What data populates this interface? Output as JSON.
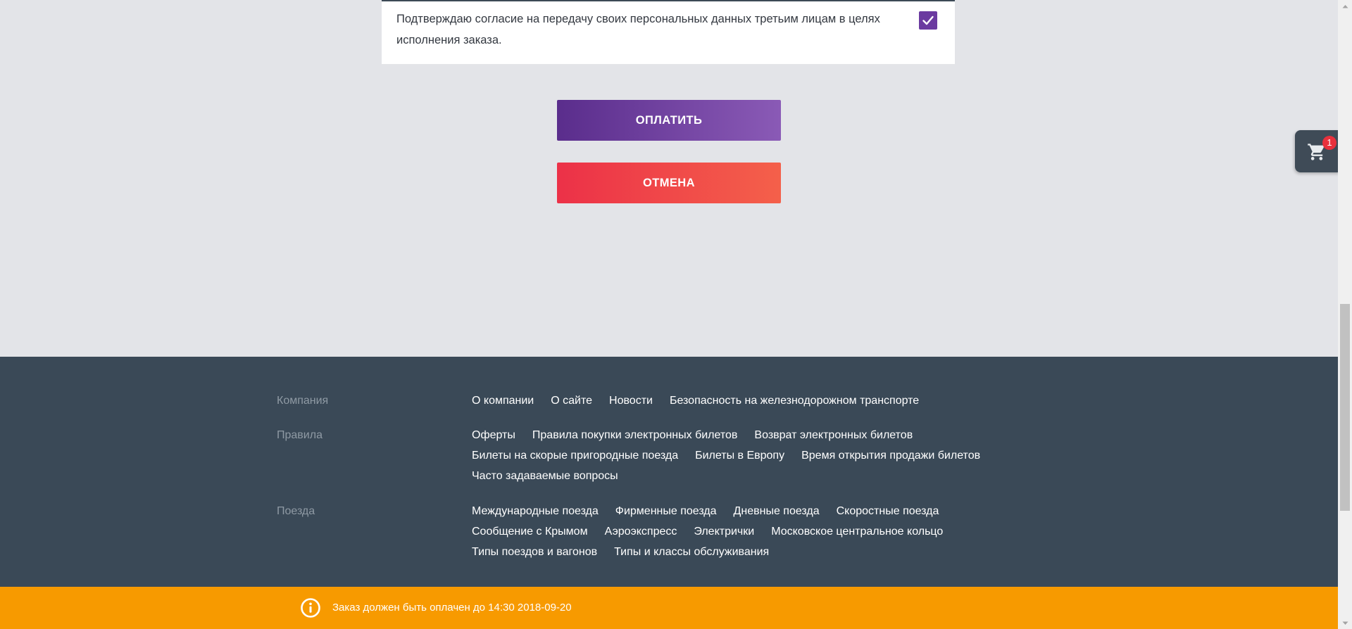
{
  "consent": {
    "text": "Подтверждаю согласие на передачу своих персональных данных третьим лицам в целях исполнения заказа.",
    "checked": true,
    "checkbox_color": "#6b3aa0"
  },
  "actions": {
    "pay_label": "ОПЛАТИТЬ",
    "cancel_label": "ОТМЕНА"
  },
  "cart": {
    "icon": "cart-icon",
    "count": "1"
  },
  "footer": {
    "sections": [
      {
        "title": "Компания",
        "links": [
          "О компании",
          "О сайте",
          "Новости",
          "Безопасность на железнодорожном транспорте"
        ]
      },
      {
        "title": "Правила",
        "links": [
          "Оферты",
          "Правила покупки электронных билетов",
          "Возврат электронных билетов",
          "Билеты на скорые пригородные поезда",
          "Билеты в Европу",
          "Время открытия продажи билетов",
          "Часто задаваемые вопросы"
        ]
      },
      {
        "title": "Поезда",
        "links": [
          "Международные поезда",
          "Фирменные поезда",
          "Дневные поезда",
          "Скоростные поезда",
          "Сообщение с Крымом",
          "Аэроэкспресс",
          "Электрички",
          "Московское центральное кольцо",
          "Типы поездов и вагонов",
          "Типы и классы обслуживания"
        ]
      }
    ]
  },
  "notice": {
    "icon": "info-icon",
    "text": "Заказ должен быть оплачен до 14:30 2018-09-20"
  },
  "colors": {
    "background": "#e3e4e8",
    "footer": "#3a4957",
    "notice": "#f79a00",
    "pay_gradient": [
      "#5a2d8c",
      "#8a5ab6"
    ],
    "cancel_gradient": [
      "#ec3148",
      "#f4604a"
    ]
  }
}
